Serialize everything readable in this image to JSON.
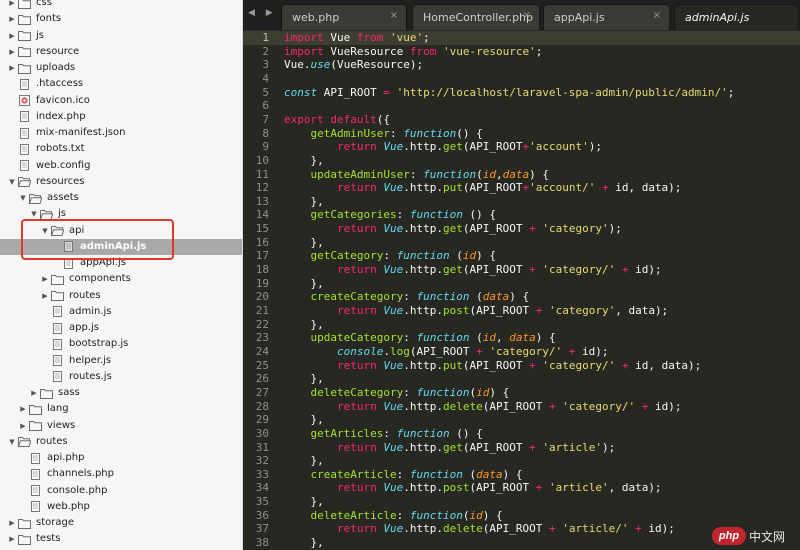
{
  "sidebar": {
    "rows": [
      {
        "label": "css",
        "type": "folder",
        "expanded": false
      },
      {
        "label": "fonts",
        "type": "folder",
        "expanded": false
      },
      {
        "label": "js",
        "type": "folder",
        "expanded": false
      },
      {
        "label": "resource",
        "type": "folder",
        "expanded": false
      },
      {
        "label": "uploads",
        "type": "folder",
        "expanded": false
      },
      {
        "label": ".htaccess",
        "type": "file"
      },
      {
        "label": "favicon.ico",
        "type": "image"
      },
      {
        "label": "index.php",
        "type": "file"
      },
      {
        "label": "mix-manifest.json",
        "type": "file"
      },
      {
        "label": "robots.txt",
        "type": "file"
      },
      {
        "label": "web.config",
        "type": "file"
      },
      {
        "label": "resources",
        "type": "folder",
        "expanded": true
      },
      {
        "label": "assets",
        "type": "folder",
        "expanded": true
      },
      {
        "label": "js",
        "type": "folder",
        "expanded": true
      },
      {
        "label": "api",
        "type": "folder",
        "expanded": true
      },
      {
        "label": "adminApi.js",
        "type": "file",
        "selected": true
      },
      {
        "label": "appApi.js",
        "type": "file"
      },
      {
        "label": "components",
        "type": "folder",
        "expanded": false
      },
      {
        "label": "routes",
        "type": "folder",
        "expanded": false
      },
      {
        "label": "admin.js",
        "type": "file"
      },
      {
        "label": "app.js",
        "type": "file"
      },
      {
        "label": "bootstrap.js",
        "type": "file"
      },
      {
        "label": "helper.js",
        "type": "file"
      },
      {
        "label": "routes.js",
        "type": "file"
      },
      {
        "label": "sass",
        "type": "folder",
        "expanded": false
      },
      {
        "label": "lang",
        "type": "folder",
        "expanded": false
      },
      {
        "label": "views",
        "type": "folder",
        "expanded": false
      },
      {
        "label": "routes",
        "type": "folder",
        "expanded": true
      },
      {
        "label": "api.php",
        "type": "file"
      },
      {
        "label": "channels.php",
        "type": "file"
      },
      {
        "label": "console.php",
        "type": "file"
      },
      {
        "label": "web.php",
        "type": "file"
      },
      {
        "label": "storage",
        "type": "folder",
        "expanded": false
      },
      {
        "label": "tests",
        "type": "folder",
        "expanded": false
      }
    ]
  },
  "tabs": [
    {
      "label": "web.php",
      "active": false
    },
    {
      "label": "HomeController.php",
      "active": false
    },
    {
      "label": "appApi.js",
      "active": false
    },
    {
      "label": "adminApi.js",
      "active": true
    }
  ],
  "tab_close_glyph": "×",
  "nav_arrows": "◀ ▶",
  "editor": {
    "current_line": 1,
    "lines": [
      [
        [
          "kw",
          "import"
        ],
        [
          "pl",
          " Vue "
        ],
        [
          "kw",
          "from"
        ],
        [
          "pl",
          " "
        ],
        [
          "str",
          "'vue'"
        ],
        [
          "pl",
          ";"
        ]
      ],
      [
        [
          "kw",
          "import"
        ],
        [
          "pl",
          " VueResource "
        ],
        [
          "kw",
          "from"
        ],
        [
          "pl",
          " "
        ],
        [
          "str",
          "'vue-resource'"
        ],
        [
          "pl",
          ";"
        ]
      ],
      [
        [
          "pl",
          "Vue."
        ],
        [
          "st",
          "use"
        ],
        [
          "pl",
          "(VueResource);"
        ]
      ],
      [],
      [
        [
          "st",
          "const"
        ],
        [
          "pl",
          " API_ROOT "
        ],
        [
          "kw",
          "="
        ],
        [
          "pl",
          " "
        ],
        [
          "str",
          "'http://localhost/laravel-spa-admin/public/admin/'"
        ],
        [
          "pl",
          ";"
        ]
      ],
      [],
      [
        [
          "kw",
          "export"
        ],
        [
          "pl",
          " "
        ],
        [
          "kw",
          "default"
        ],
        [
          "pl",
          "({"
        ]
      ],
      [
        [
          "pl",
          "    "
        ],
        [
          "fn",
          "getAdminUser"
        ],
        [
          "pl",
          ": "
        ],
        [
          "st",
          "function"
        ],
        [
          "pl",
          "() {"
        ]
      ],
      [
        [
          "pl",
          "        "
        ],
        [
          "kw",
          "return"
        ],
        [
          "pl",
          " "
        ],
        [
          "st",
          "Vue"
        ],
        [
          "pl",
          ".http."
        ],
        [
          "fn",
          "get"
        ],
        [
          "pl",
          "(API_ROOT"
        ],
        [
          "kw",
          "+"
        ],
        [
          "str",
          "'account'"
        ],
        [
          "pl",
          ");"
        ]
      ],
      [
        [
          "pl",
          "    },"
        ]
      ],
      [
        [
          "pl",
          "    "
        ],
        [
          "fn",
          "updateAdminUser"
        ],
        [
          "pl",
          ": "
        ],
        [
          "st",
          "function"
        ],
        [
          "pl",
          "("
        ],
        [
          "par",
          "id"
        ],
        [
          "pl",
          ","
        ],
        [
          "par",
          "data"
        ],
        [
          "pl",
          ") {"
        ]
      ],
      [
        [
          "pl",
          "        "
        ],
        [
          "kw",
          "return"
        ],
        [
          "pl",
          " "
        ],
        [
          "st",
          "Vue"
        ],
        [
          "pl",
          ".http."
        ],
        [
          "fn",
          "put"
        ],
        [
          "pl",
          "(API_ROOT"
        ],
        [
          "kw",
          "+"
        ],
        [
          "str",
          "'account/'"
        ],
        [
          "pl",
          " "
        ],
        [
          "kw",
          "+"
        ],
        [
          "pl",
          " id, data);"
        ]
      ],
      [
        [
          "pl",
          "    },"
        ]
      ],
      [
        [
          "pl",
          "    "
        ],
        [
          "fn",
          "getCategories"
        ],
        [
          "pl",
          ": "
        ],
        [
          "st",
          "function"
        ],
        [
          "pl",
          " () {"
        ]
      ],
      [
        [
          "pl",
          "        "
        ],
        [
          "kw",
          "return"
        ],
        [
          "pl",
          " "
        ],
        [
          "st",
          "Vue"
        ],
        [
          "pl",
          ".http."
        ],
        [
          "fn",
          "get"
        ],
        [
          "pl",
          "(API_ROOT "
        ],
        [
          "kw",
          "+"
        ],
        [
          "pl",
          " "
        ],
        [
          "str",
          "'category'"
        ],
        [
          "pl",
          ");"
        ]
      ],
      [
        [
          "pl",
          "    },"
        ]
      ],
      [
        [
          "pl",
          "    "
        ],
        [
          "fn",
          "getCategory"
        ],
        [
          "pl",
          ": "
        ],
        [
          "st",
          "function"
        ],
        [
          "pl",
          " ("
        ],
        [
          "par",
          "id"
        ],
        [
          "pl",
          ") {"
        ]
      ],
      [
        [
          "pl",
          "        "
        ],
        [
          "kw",
          "return"
        ],
        [
          "pl",
          " "
        ],
        [
          "st",
          "Vue"
        ],
        [
          "pl",
          ".http."
        ],
        [
          "fn",
          "get"
        ],
        [
          "pl",
          "(API_ROOT "
        ],
        [
          "kw",
          "+"
        ],
        [
          "pl",
          " "
        ],
        [
          "str",
          "'category/'"
        ],
        [
          "pl",
          " "
        ],
        [
          "kw",
          "+"
        ],
        [
          "pl",
          " id);"
        ]
      ],
      [
        [
          "pl",
          "    },"
        ]
      ],
      [
        [
          "pl",
          "    "
        ],
        [
          "fn",
          "createCategory"
        ],
        [
          "pl",
          ": "
        ],
        [
          "st",
          "function"
        ],
        [
          "pl",
          " ("
        ],
        [
          "par",
          "data"
        ],
        [
          "pl",
          ") {"
        ]
      ],
      [
        [
          "pl",
          "        "
        ],
        [
          "kw",
          "return"
        ],
        [
          "pl",
          " "
        ],
        [
          "st",
          "Vue"
        ],
        [
          "pl",
          ".http."
        ],
        [
          "fn",
          "post"
        ],
        [
          "pl",
          "(API_ROOT "
        ],
        [
          "kw",
          "+"
        ],
        [
          "pl",
          " "
        ],
        [
          "str",
          "'category'"
        ],
        [
          "pl",
          ", data);"
        ]
      ],
      [
        [
          "pl",
          "    },"
        ]
      ],
      [
        [
          "pl",
          "    "
        ],
        [
          "fn",
          "updateCategory"
        ],
        [
          "pl",
          ": "
        ],
        [
          "st",
          "function"
        ],
        [
          "pl",
          " ("
        ],
        [
          "par",
          "id"
        ],
        [
          "pl",
          ", "
        ],
        [
          "par",
          "data"
        ],
        [
          "pl",
          ") {"
        ]
      ],
      [
        [
          "pl",
          "        "
        ],
        [
          "st",
          "console"
        ],
        [
          "pl",
          "."
        ],
        [
          "fn",
          "log"
        ],
        [
          "pl",
          "(API_ROOT "
        ],
        [
          "kw",
          "+"
        ],
        [
          "pl",
          " "
        ],
        [
          "str",
          "'category/'"
        ],
        [
          "pl",
          " "
        ],
        [
          "kw",
          "+"
        ],
        [
          "pl",
          " id);"
        ]
      ],
      [
        [
          "pl",
          "        "
        ],
        [
          "kw",
          "return"
        ],
        [
          "pl",
          " "
        ],
        [
          "st",
          "Vue"
        ],
        [
          "pl",
          ".http."
        ],
        [
          "fn",
          "put"
        ],
        [
          "pl",
          "(API_ROOT "
        ],
        [
          "kw",
          "+"
        ],
        [
          "pl",
          " "
        ],
        [
          "str",
          "'category/'"
        ],
        [
          "pl",
          " "
        ],
        [
          "kw",
          "+"
        ],
        [
          "pl",
          " id, data);"
        ]
      ],
      [
        [
          "pl",
          "    },"
        ]
      ],
      [
        [
          "pl",
          "    "
        ],
        [
          "fn",
          "deleteCategory"
        ],
        [
          "pl",
          ": "
        ],
        [
          "st",
          "function"
        ],
        [
          "pl",
          "("
        ],
        [
          "par",
          "id"
        ],
        [
          "pl",
          ") {"
        ]
      ],
      [
        [
          "pl",
          "        "
        ],
        [
          "kw",
          "return"
        ],
        [
          "pl",
          " "
        ],
        [
          "st",
          "Vue"
        ],
        [
          "pl",
          ".http."
        ],
        [
          "fn",
          "delete"
        ],
        [
          "pl",
          "(API_ROOT "
        ],
        [
          "kw",
          "+"
        ],
        [
          "pl",
          " "
        ],
        [
          "str",
          "'category/'"
        ],
        [
          "pl",
          " "
        ],
        [
          "kw",
          "+"
        ],
        [
          "pl",
          " id);"
        ]
      ],
      [
        [
          "pl",
          "    },"
        ]
      ],
      [
        [
          "pl",
          "    "
        ],
        [
          "fn",
          "getArticles"
        ],
        [
          "pl",
          ": "
        ],
        [
          "st",
          "function"
        ],
        [
          "pl",
          " () {"
        ]
      ],
      [
        [
          "pl",
          "        "
        ],
        [
          "kw",
          "return"
        ],
        [
          "pl",
          " "
        ],
        [
          "st",
          "Vue"
        ],
        [
          "pl",
          ".http."
        ],
        [
          "fn",
          "get"
        ],
        [
          "pl",
          "(API_ROOT "
        ],
        [
          "kw",
          "+"
        ],
        [
          "pl",
          " "
        ],
        [
          "str",
          "'article'"
        ],
        [
          "pl",
          ");"
        ]
      ],
      [
        [
          "pl",
          "    },"
        ]
      ],
      [
        [
          "pl",
          "    "
        ],
        [
          "fn",
          "createArticle"
        ],
        [
          "pl",
          ": "
        ],
        [
          "st",
          "function"
        ],
        [
          "pl",
          " ("
        ],
        [
          "par",
          "data"
        ],
        [
          "pl",
          ") {"
        ]
      ],
      [
        [
          "pl",
          "        "
        ],
        [
          "kw",
          "return"
        ],
        [
          "pl",
          " "
        ],
        [
          "st",
          "Vue"
        ],
        [
          "pl",
          ".http."
        ],
        [
          "fn",
          "post"
        ],
        [
          "pl",
          "(API_ROOT "
        ],
        [
          "kw",
          "+"
        ],
        [
          "pl",
          " "
        ],
        [
          "str",
          "'article'"
        ],
        [
          "pl",
          ", data);"
        ]
      ],
      [
        [
          "pl",
          "    },"
        ]
      ],
      [
        [
          "pl",
          "    "
        ],
        [
          "fn",
          "deleteArticle"
        ],
        [
          "pl",
          ": "
        ],
        [
          "st",
          "function"
        ],
        [
          "pl",
          "("
        ],
        [
          "par",
          "id"
        ],
        [
          "pl",
          ") {"
        ]
      ],
      [
        [
          "pl",
          "        "
        ],
        [
          "kw",
          "return"
        ],
        [
          "pl",
          " "
        ],
        [
          "st",
          "Vue"
        ],
        [
          "pl",
          ".http."
        ],
        [
          "fn",
          "delete"
        ],
        [
          "pl",
          "(API_ROOT "
        ],
        [
          "kw",
          "+"
        ],
        [
          "pl",
          " "
        ],
        [
          "str",
          "'article/'"
        ],
        [
          "pl",
          " "
        ],
        [
          "kw",
          "+"
        ],
        [
          "pl",
          " id);"
        ]
      ],
      [
        [
          "pl",
          "    },"
        ]
      ]
    ]
  },
  "watermark": {
    "logo": "php",
    "text": "中文网"
  },
  "colors": {
    "editor_bg": "#272822",
    "sidebar_bg": "#f6f6f6",
    "selection_bg": "#a9a9a9",
    "highlight_border": "#e03a2e",
    "keyword": "#f92672",
    "string": "#e6db74",
    "function_name": "#a6e22e",
    "storage": "#66d9ef",
    "parameter": "#fd971f"
  }
}
